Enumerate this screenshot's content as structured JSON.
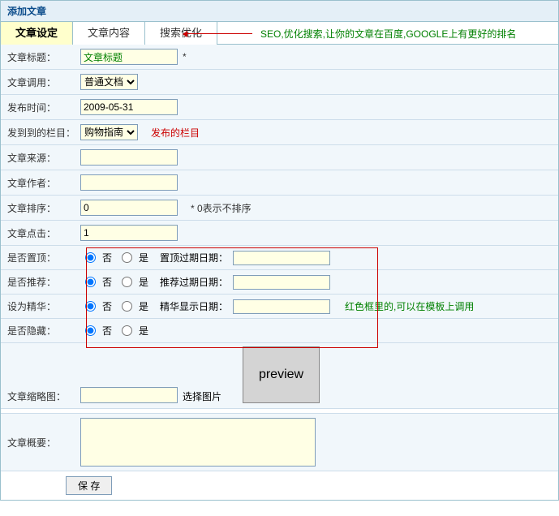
{
  "page_title": "添加文章",
  "tabs": {
    "settings": "文章设定",
    "content": "文章内容",
    "seo": "搜索优化"
  },
  "seo_note": "SEO,优化搜索,让你的文章在百度,GOOGLE上有更好的排名",
  "labels": {
    "title": "文章标题：",
    "call": "文章调用：",
    "pubtime": "发布时间：",
    "column": "发到到的栏目：",
    "source": "文章来源：",
    "author": "文章作者：",
    "sort": "文章排序：",
    "hits": "文章点击：",
    "top": "是否置顶：",
    "recommend": "是否推荐：",
    "essence": "设为精华：",
    "hidden": "是否隐藏：",
    "thumb": "文章缩略图：",
    "summary": "文章概要："
  },
  "fields": {
    "title_value": "文章标题",
    "title_star": "*",
    "call_select": "普通文档",
    "pubtime_value": "2009-05-31",
    "column_select": "购物指南",
    "column_note": "发布的栏目",
    "source_value": "",
    "author_value": "",
    "sort_value": "0",
    "sort_hint": "* 0表示不排序",
    "hits_value": "1",
    "radio_no": "否",
    "radio_yes": "是",
    "top_date_label": "置顶过期日期：",
    "recommend_date_label": "推荐过期日期：",
    "essence_date_label": "精华显示日期：",
    "top_date": "",
    "recommend_date": "",
    "essence_date": "",
    "redbox_note": "红色框里的,可以在模板上调用",
    "thumb_value": "",
    "thumb_btn": "选择图片",
    "preview_text": "preview",
    "summary_value": ""
  },
  "save_btn": "保 存"
}
